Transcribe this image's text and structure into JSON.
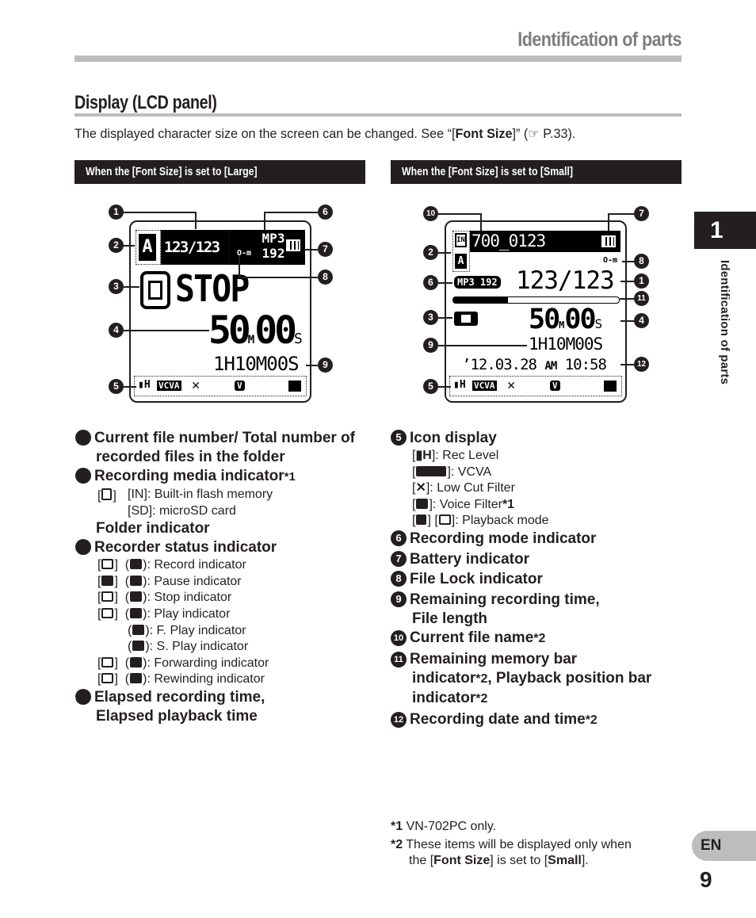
{
  "header": {
    "title": "Identification of parts"
  },
  "section": {
    "title": "Display (LCD panel)",
    "intro_before": "The displayed character size on the screen can be changed. See “[",
    "intro_bold": "Font Size",
    "intro_after": "]” (☞ P.33)."
  },
  "panels": {
    "large": {
      "band": "When the [Font Size] is set to [Large]",
      "folder": "A",
      "file_counter": "123/123",
      "rec_mode_line1": "MP3",
      "rec_mode_line2": "192",
      "lock": "O-m",
      "status": "STOP",
      "elapsed_min": "50",
      "elapsed_min_unit": "M",
      "elapsed_sec": "00",
      "elapsed_sec_unit": "S",
      "remaining": "1H10M00S",
      "icons": {
        "rec_level": "H",
        "vcva": "VCVA",
        "lowcut": "✕",
        "voice_filter": "V"
      },
      "callouts": [
        "1",
        "2",
        "3",
        "4",
        "5",
        "6",
        "7",
        "8",
        "9"
      ]
    },
    "small": {
      "band": "When the [Font Size] is set to [Small]",
      "media": "IN",
      "folder": "A",
      "file_name": "700_0123",
      "lock": "O-m",
      "rec_mode": "MP3 192",
      "file_counter": "123/123",
      "memory_bar_fraction": 0.33,
      "elapsed_min": "50",
      "elapsed_min_unit": "M",
      "elapsed_sec": "00",
      "elapsed_sec_unit": "S",
      "remaining": "1H10M00S",
      "date": "’12.03.28",
      "ampm": "AM",
      "time": "10:58",
      "icons": {
        "rec_level": "H",
        "vcva": "VCVA",
        "lowcut": "✕",
        "voice_filter": "V"
      },
      "callouts": [
        "10",
        "7",
        "2",
        "8",
        "6",
        "1",
        "11",
        "3",
        "4",
        "9",
        "12",
        "5"
      ]
    }
  },
  "left_items": [
    {
      "num": "1",
      "title": "Current file number/ Total number of recorded files in the folder"
    },
    {
      "num": "2",
      "title": "Recording media indicator",
      "note": "*1",
      "subs": [
        "[IN]: Built-in flash memory",
        "[SD]: microSD card"
      ]
    },
    {
      "num": "",
      "title": "Folder indicator"
    },
    {
      "num": "3",
      "title": "Recorder status indicator",
      "subs": [
        "Record indicator",
        "Pause indicator",
        "Stop indicator",
        "Play indicator",
        "F. Play indicator",
        "S. Play indicator",
        "Forwarding indicator",
        "Rewinding indicator"
      ]
    },
    {
      "num": "4",
      "title": "Elapsed recording time, Elapsed playback time"
    }
  ],
  "right_items": [
    {
      "num": "5",
      "title": "Icon display",
      "subs": [
        "Rec Level",
        "VCVA",
        "Low Cut Filter",
        "Voice Filter",
        "Playback mode"
      ],
      "voice_note": "*1"
    },
    {
      "num": "6",
      "title": "Recording mode indicator"
    },
    {
      "num": "7",
      "title": "Battery indicator"
    },
    {
      "num": "8",
      "title": "File Lock indicator"
    },
    {
      "num": "9",
      "title": "Remaining recording time,",
      "title2": "File length"
    },
    {
      "num": "10",
      "title": "Current file name",
      "note": "*2"
    },
    {
      "num": "11",
      "title": "Remaining memory bar",
      "title2a": "indicator",
      "note": "*2",
      "title2b": ", Playback position bar",
      "title3": "indicator",
      "note3": "*2"
    },
    {
      "num": "12",
      "title": "Recording date and time",
      "note": "*2"
    }
  ],
  "footnotes": [
    {
      "mark": "*1",
      "text": "VN-702PC only."
    },
    {
      "mark": "*2",
      "text_before": "These items will be displayed only when",
      "text2a": "the [",
      "bold1": "Font Size",
      "text2b": "] is set to [",
      "bold2": "Small",
      "text2c": "]."
    }
  ],
  "side": {
    "chapter": "1",
    "label": "Identification of parts",
    "lang": "EN",
    "page": "9"
  }
}
